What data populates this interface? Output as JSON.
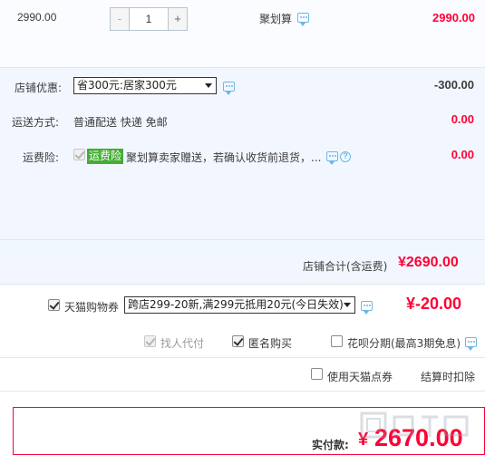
{
  "item": {
    "unit_price": "2990.00",
    "quantity": "1",
    "minus_label": "-",
    "plus_label": "+",
    "promo_label": "聚划算",
    "subtotal": "2990.00"
  },
  "shop_discount": {
    "label": "店铺优惠:",
    "selected": "省300元:居家300元",
    "amount": "-300.00"
  },
  "shipping": {
    "label": "运送方式:",
    "value": "普通配送 快递 免邮",
    "amount": "0.00"
  },
  "shipping_insurance": {
    "label": "运费险:",
    "tag": "运费险",
    "description": "聚划算卖家赠送，若确认收货前退货，...",
    "amount": "0.00"
  },
  "shop_total": {
    "label": "店铺合计(含运费)",
    "amount": "¥2690.00"
  },
  "coupon": {
    "label": "天猫购物券",
    "selected": "跨店299-20新,满299元抵用20元(今日失效)",
    "amount": "¥-20.00"
  },
  "options": {
    "find_proxy": "找人代付",
    "anonymous": "匿名购买",
    "huabei": "花呗分期(最高3期免息)",
    "tmall_points": "使用天猫点券",
    "points_note": "结算时扣除"
  },
  "payment": {
    "label": "实付款:",
    "currency": "¥",
    "amount": "2670.00"
  },
  "colors": {
    "accent_red": "#ff0036",
    "panel_blue": "#f2f7ff",
    "tag_green": "#44ad34",
    "icon_blue": "#6cb7e8"
  }
}
